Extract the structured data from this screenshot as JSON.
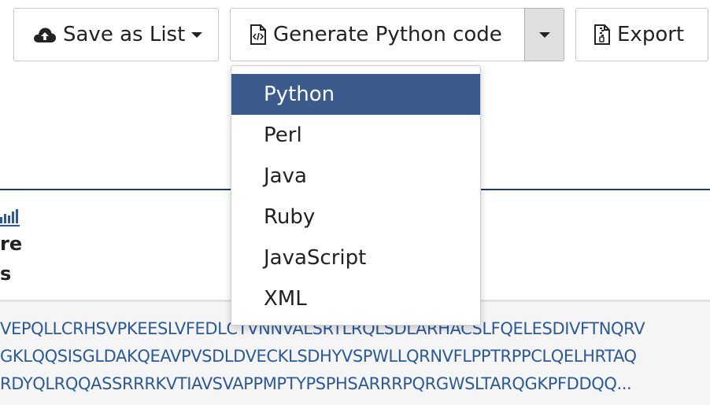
{
  "toolbar": {
    "save_label": "Save as List",
    "generate_label": "Generate Python code",
    "export_label": "Export"
  },
  "menu": {
    "items": [
      "Python",
      "Perl",
      "Java",
      "Ruby",
      "JavaScript",
      "XML"
    ],
    "selected": "Python"
  },
  "left_fragments": {
    "line1": "re",
    "line2": "s"
  },
  "sequences": [
    "VEPQLLCRHSVPKEESLVFEDLCTVNNVALSRTLRQLSDLARHACSLFQELESDIVFTNQRV",
    "GKLQQSISGLDAKQEAVPVSDLDVECKLSDHYVSPWLLQRNVFLPPTRPPCLQELHRTAQ",
    "RDYQLRQQASSRRRKVTIAVSVAPPMPTYPSPHSARRRPQRGWSLTARQGKPFDDQQ..."
  ],
  "colors": {
    "accent": "#3b5b8c",
    "divider": "#1e3a66",
    "sequence_text": "#2b5a9b",
    "caret_bg": "#e0e0e0"
  },
  "icons": [
    "cloud-upload-icon",
    "caret-down-icon",
    "file-code-icon",
    "file-zip-icon",
    "bar-chart-icon"
  ]
}
